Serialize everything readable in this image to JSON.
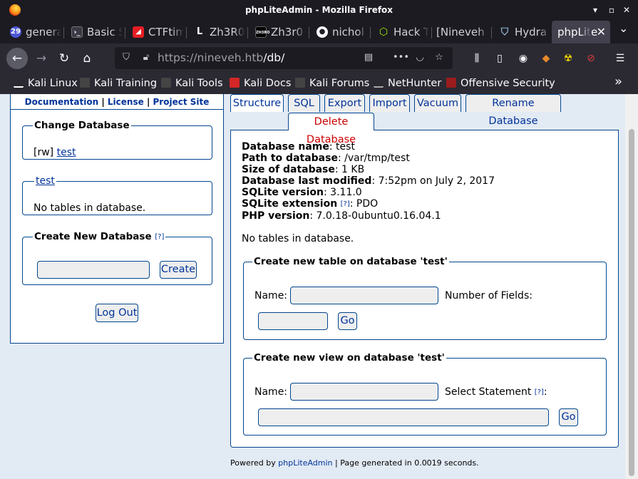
{
  "window": {
    "title": "phpLiteAdmin - Mozilla Firefox"
  },
  "tabs": [
    {
      "label": "general",
      "icon": "twentynine-icon"
    },
    {
      "label": "Basic S",
      "icon": "terminal-icon"
    },
    {
      "label": "CTFtim",
      "icon": "ctftime-icon"
    },
    {
      "label": "Zh3R0",
      "icon": "l-icon"
    },
    {
      "label": "Zh3r0",
      "icon": "zh3r0-icon"
    },
    {
      "label": "nichol",
      "icon": "github-icon"
    },
    {
      "label": "Hack T",
      "icon": "cube-icon"
    },
    {
      "label": "[Nineveh",
      "icon": "none"
    },
    {
      "label": "Hydra",
      "icon": "shield-icon"
    },
    {
      "label": "phpLite",
      "icon": "none",
      "active": true
    }
  ],
  "navbar": {
    "url_host": "https://nineveh.htb",
    "url_path": "/db/"
  },
  "bookmarks": [
    {
      "label": "Kali Linux"
    },
    {
      "label": "Kali Training"
    },
    {
      "label": "Kali Tools"
    },
    {
      "label": "Kali Docs"
    },
    {
      "label": "Kali Forums"
    },
    {
      "label": "NetHunter"
    },
    {
      "label": "Offensive Security"
    }
  ],
  "sidebar": {
    "links": {
      "documentation": "Documentation",
      "license": "License",
      "project_site": "Project Site",
      "sep": "|"
    },
    "change_db": {
      "legend": "Change Database",
      "mode": "[rw]",
      "db_link": "test"
    },
    "tables_box": {
      "legend": "test",
      "message": "No tables in database."
    },
    "create_db": {
      "legend": "Create New Database",
      "help": "[?]",
      "input_value": "",
      "button": "Create"
    },
    "logout": "Log Out"
  },
  "main": {
    "tabs": [
      "Structure",
      "SQL",
      "Export",
      "Import",
      "Vacuum",
      "Rename Database"
    ],
    "delete_tab": "Delete Database",
    "info": [
      {
        "label": "Database name",
        "value": ": test"
      },
      {
        "label": "Path to database",
        "value": ": /var/tmp/test"
      },
      {
        "label": "Size of database",
        "value": ": 1 KB"
      },
      {
        "label": "Database last modified",
        "value": ": 7:52pm on July 2, 2017"
      },
      {
        "label": "SQLite version",
        "value": ": 3.11.0"
      },
      {
        "label": "SQLite extension",
        "help": "[?]",
        "value": ": PDO"
      },
      {
        "label": "PHP version",
        "value": ": 7.0.18-0ubuntu0.16.04.1"
      }
    ],
    "no_tables": "No tables in database.",
    "create_table": {
      "legend": "Create new table on database 'test'",
      "name_label": "Name:",
      "fields_label": "Number of Fields:",
      "go": "Go"
    },
    "create_view": {
      "legend": "Create new view on database 'test'",
      "name_label": "Name:",
      "select_label": "Select Statement",
      "help": "[?]",
      "colon": ":",
      "go": "Go"
    }
  },
  "footer": {
    "prefix": "Powered by ",
    "link": "phpLiteAdmin",
    "suffix": " | Page generated in 0.0019 seconds."
  }
}
